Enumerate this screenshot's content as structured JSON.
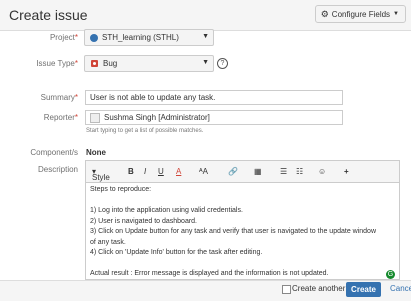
{
  "header": {
    "title": "Create issue",
    "configure_label": "Configure Fields"
  },
  "fields": {
    "project": {
      "label": "Project",
      "value": "STH_learning (STHL)"
    },
    "issue_type": {
      "label": "Issue Type",
      "value": "Bug"
    },
    "summary": {
      "label": "Summary",
      "value": "User is not able to update any task."
    },
    "reporter": {
      "label": "Reporter",
      "value": "Sushma Singh [Administrator]",
      "hint": "Start typing to get a list of possible matches."
    },
    "components": {
      "label": "Component/s",
      "value": "None"
    },
    "description": {
      "label": "Description",
      "toolbar": {
        "style": "Style",
        "bold": "B",
        "italic": "I",
        "underline": "U",
        "color": "A",
        "more_format": "ᴬA",
        "link": "🔗",
        "table": "▦",
        "bullets": "☰",
        "numbers": "☷",
        "emoji": "☺",
        "insert": "+"
      },
      "lines": [
        "Steps to reproduce:",
        "",
        "1) Log into the application using valid credentials.",
        "2) User is navigated to dashboard.",
        "3) Click on Update button for any task and verify that user is navigated to the update window",
        "of any task.",
        "4) Click on 'Update Info' button for the task after editing.",
        "",
        "Actual result : Error message is displayed and the information is not updated."
      ]
    }
  },
  "footer": {
    "create_another": "Create another",
    "create": "Create",
    "cancel": "Cancel"
  }
}
